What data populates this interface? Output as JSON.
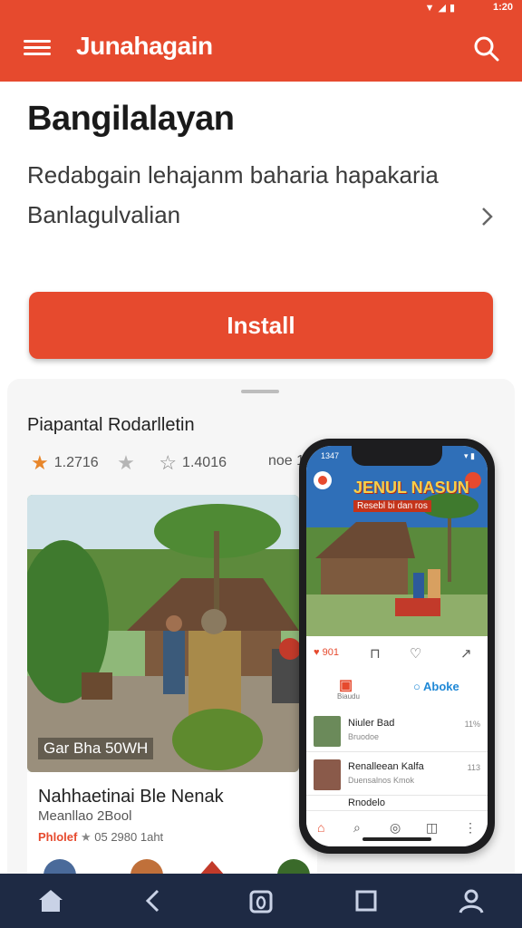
{
  "status_bar": {
    "time": "1:20"
  },
  "app_bar": {
    "title": "Junahagain"
  },
  "heading": "Bangilalayan",
  "description": {
    "line1": "Redabgain lehajanm baharia hapakaria",
    "line2": "Banlagulvalian"
  },
  "install_label": "Install",
  "sheet": {
    "title": "Piapantal Rodarlletin",
    "ratings": [
      {
        "value": "1.2716",
        "icon": "star-filled-icon"
      },
      {
        "value": "",
        "icon": "star-gray-icon"
      },
      {
        "value": "1.4016",
        "icon": "star-outline-icon"
      }
    ],
    "more_text": "noe 1D",
    "photo_caption": "Gar Bha 50WH",
    "card": {
      "title": "Nahhaetinai Ble Nenak",
      "subtitle": "Meanllao 2Bool",
      "label": "Phlolef",
      "meta": "05 2980 1aht"
    }
  },
  "phone": {
    "time": "1347",
    "banner_title": "JENUL NASUN",
    "banner_subtitle": "Resebl bi dan ros",
    "action_count": "901",
    "tab_left_sub": "Biaudu",
    "tab_right": "Aboke",
    "list": [
      {
        "name": "Niuler Bad",
        "sub": "Bruodoe",
        "count": "11%"
      },
      {
        "name": "Renalleean Kalfa",
        "sub": "Duensalnos Kmok",
        "count": "113"
      },
      {
        "name": "Rnodelo",
        "sub": "",
        "count": ""
      }
    ]
  },
  "colors": {
    "accent": "#e64a2e",
    "nav_bar": "#1e2a44",
    "link_blue": "#1f88d6"
  }
}
